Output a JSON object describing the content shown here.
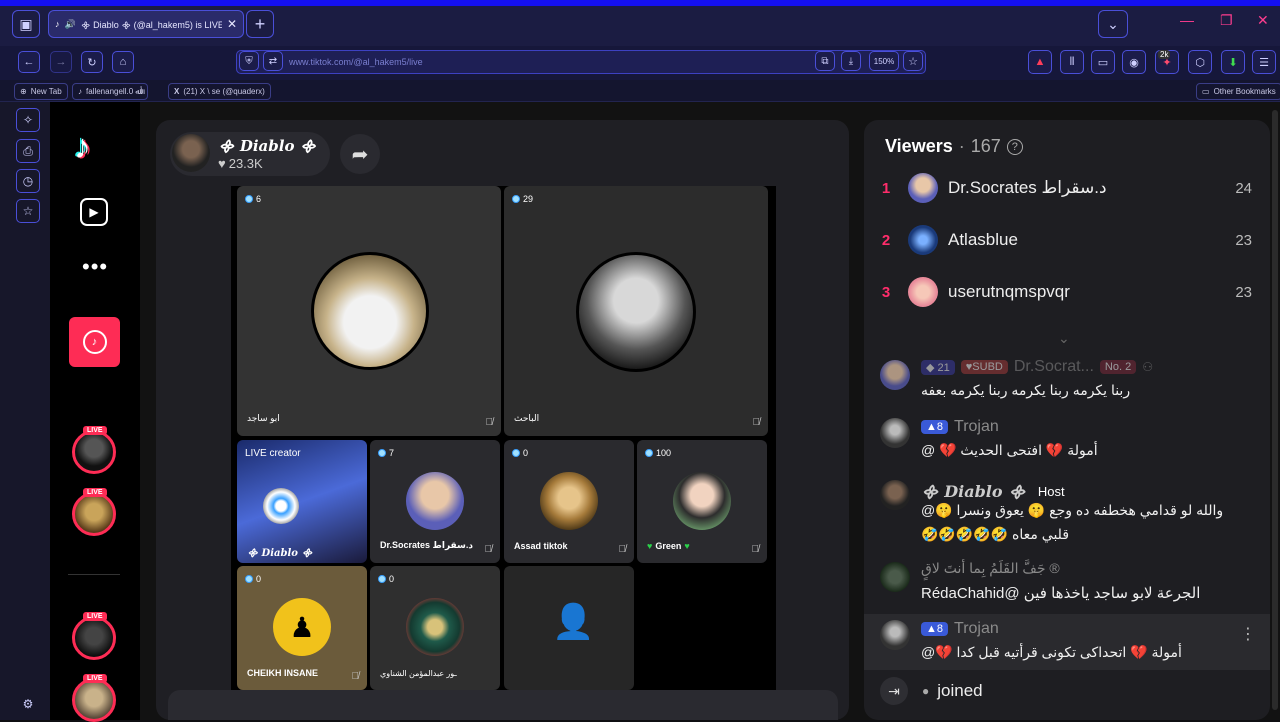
{
  "browser": {
    "tab_title": "᯽ Diablo ᯽ (@al_hakem5) is LIVE",
    "url": "www.tiktok.com/@al_hakem5/live",
    "zoom": "150%",
    "ext_badge": "2k",
    "bookmarks": [
      "New Tab",
      "fallenangell.0 أﷲ",
      "(21) X \\ se (@quaderx)"
    ],
    "other_bookmarks": "Other Bookmarks"
  },
  "host": {
    "name": "᯽ Diablo ᯽",
    "likes": "23.3K"
  },
  "grid": {
    "big": [
      {
        "count": "6",
        "name": "ابو ساجد"
      },
      {
        "count": "29",
        "name": "الباحث"
      }
    ],
    "small": [
      {
        "count": "",
        "name": "᯽ Diablo ᯽",
        "label": "LIVE creator"
      },
      {
        "count": "7",
        "name": "Dr.Socrates د.سقراط"
      },
      {
        "count": "0",
        "name": "Assad tiktok"
      },
      {
        "count": "100",
        "name": "Green"
      },
      {
        "count": "0",
        "name": "CHEIKH INSANE"
      },
      {
        "count": "0",
        "name": "ـور عبدالمؤمن الشناوي"
      }
    ]
  },
  "viewers": {
    "title": "Viewers",
    "count": "167",
    "top": [
      {
        "rank": "1",
        "name": "Dr.Socrates د.سقراط",
        "score": "24"
      },
      {
        "rank": "2",
        "name": "Atlasblue",
        "score": "23"
      },
      {
        "rank": "3",
        "name": "userutnqmspvqr",
        "score": "23"
      }
    ]
  },
  "chat": [
    {
      "name": "Dr.Socrat...",
      "level": "21",
      "badge": "SUBD",
      "rank": "No. 2",
      "text": "ربنا يكرمه ربنا يكرمه ربنا يكرمه بعفه"
    },
    {
      "name": "Trojan",
      "level": "8",
      "text": "أمولة 💔 افتحى الحديث 💔 @"
    },
    {
      "name": "᯽ Diablo ᯽",
      "role": "Host",
      "text": "والله لو قدامي هخطفه ده وجع 🤫 يعوق ونسرا 🤫@",
      "text2": "قلبي معاه 🤣🤣🤣🤣🤣"
    },
    {
      "name": "® جَفَّ القَلَمُ بِما أنتَ لاقٍ",
      "text": "الجرعة لابو ساجد ياخذها فين @RédaChahid"
    },
    {
      "name": "Trojan",
      "level": "8",
      "text": "أمولة 💔 اتحداكى تكونى قرأتيه قبل كدا 💔@"
    }
  ],
  "joined": "joined",
  "colors": {
    "accent": "#fe2c55",
    "browser": "#1410f0"
  }
}
